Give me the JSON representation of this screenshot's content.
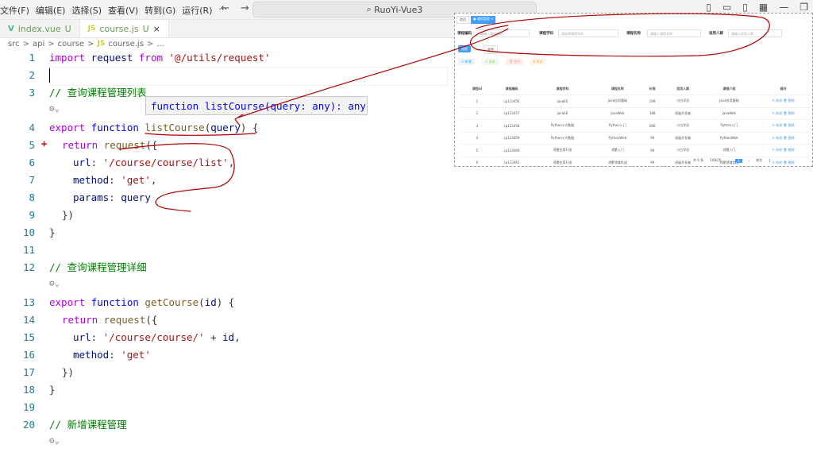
{
  "titlebar": {
    "menu": [
      "文件(F)",
      "编辑(E)",
      "选择(S)",
      "查看(V)",
      "转到(G)",
      "运行(R)",
      "···"
    ],
    "search": "RuoYi-Vue3"
  },
  "tabs": [
    {
      "icon": "V",
      "name": "index.vue",
      "status": "U"
    },
    {
      "icon": "JS",
      "name": "course.js",
      "status": "U",
      "close": "×"
    }
  ],
  "breadcrumb": [
    "src",
    ">",
    "api",
    ">",
    "course",
    ">",
    "JS",
    "course.js",
    ">",
    "..."
  ],
  "hover": "function listCourse(query: any): any",
  "codelines": [
    {
      "n": "1"
    },
    {
      "n": "2"
    },
    {
      "n": "3"
    },
    {
      "n": "4"
    },
    {
      "n": "5"
    },
    {
      "n": "6"
    },
    {
      "n": "7"
    },
    {
      "n": "8"
    },
    {
      "n": "9"
    },
    {
      "n": "10"
    },
    {
      "n": "11"
    },
    {
      "n": "12"
    },
    {
      "n": "13"
    },
    {
      "n": "14"
    },
    {
      "n": "15"
    },
    {
      "n": "16"
    },
    {
      "n": "17"
    },
    {
      "n": "18"
    },
    {
      "n": "19"
    },
    {
      "n": "20"
    }
  ],
  "code": {
    "l1a": "import",
    "l1b": " request ",
    "l1c": "from",
    "l1d": " '@/utils/request'",
    "l3": "// 查询课程管理列表",
    "l4a": "export",
    "l4b": " function ",
    "l4c": "listCourse",
    "l4d": "(",
    "l4e": "query",
    "l4f": ") {",
    "l5a": "return",
    "l5b": " request",
    "l5c": "({",
    "l6a": "url",
    "l6b": ": ",
    "l6c": "'/course/course/list'",
    "l6d": ",",
    "l7a": "method",
    "l7b": ": ",
    "l7c": "'get'",
    "l7d": ",",
    "l8a": "params",
    "l8b": ": ",
    "l8c": "query",
    "l9": "})",
    "l10": "}",
    "l12": "// 查询课程管理详细",
    "l13a": "export",
    "l13b": " function ",
    "l13c": "getCourse",
    "l13d": "(",
    "l13e": "id",
    "l13f": ") {",
    "l14a": "return",
    "l14b": " request",
    "l14c": "({",
    "l15a": "url",
    "l15b": ": ",
    "l15c": "'/course/course/'",
    "l15d": " + ",
    "l15e": "id",
    "l15f": ",",
    "l16a": "method",
    "l16b": ": ",
    "l16c": "'get'",
    "l17": "})",
    "l18": "}",
    "l20": "// 新增课程管理",
    "lens": "⚙⌄"
  },
  "shot": {
    "tab1": "首页",
    "tab2": "● 课程管理 ×",
    "f1": "课程编码",
    "p1": "请输入课程编码",
    "f2": "课程学科",
    "p2": "请选择课程学科",
    "f3": "课程名称",
    "p3": "请输入课程名称",
    "f4": "适用人群",
    "p4": "请输入适用人群",
    "search": "搜索",
    "reset": "重置",
    "add": "+ 新增",
    "edit": "✎ 修改",
    "del": "🗑 删除",
    "export": "⬇ 导出",
    "headers": [
      "",
      "课程id",
      "课程编码",
      "课程学科",
      "课程名称",
      "价格",
      "适用人群",
      "课程介绍",
      "操作"
    ],
    "rows": [
      [
        "",
        "1",
        "cp123456",
        "JavaEE",
        "Java应用基础",
        "199",
        "小白学员",
        "Java应用基础"
      ],
      [
        "",
        "2",
        "cp123457",
        "JavaEE",
        "JavaWeb",
        "188",
        "初级开发者",
        "JavaWeb"
      ],
      [
        "",
        "3",
        "cp123458",
        "Python+大数据",
        "Python入门",
        "666",
        "小白学员",
        "Python入门"
      ],
      [
        "",
        "4",
        "cp123459",
        "Python+大数据",
        "PythonWeb",
        "99",
        "初级开发者",
        "PythonWeb"
      ],
      [
        "",
        "5",
        "cp123460",
        "鸿蒙应用开发",
        "鸿蒙入门",
        "99",
        "小白学员",
        "鸿蒙入门"
      ],
      [
        "",
        "6",
        "cp123461",
        "鸿蒙应用开发",
        "鸿蒙领域实战",
        "99",
        "初级开发者",
        "鸿蒙领域实战"
      ]
    ],
    "op_edit": "✎ 修改",
    "op_del": "🗑 删除",
    "total": "共 6 条",
    "pagesize": "10条/页",
    "page": "1",
    "goto": "前往",
    "gotopage": "1"
  }
}
